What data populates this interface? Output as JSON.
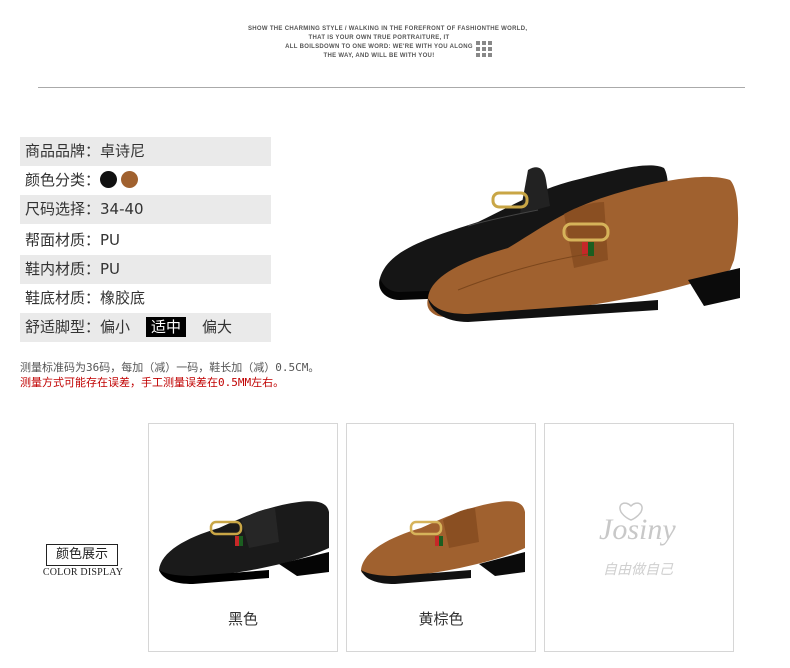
{
  "header": {
    "tagline_lines": [
      "SHOW THE CHARMING STYLE / WALKING IN THE FOREFRONT OF FASHIONTHE WORLD,",
      "THAT IS YOUR OWN TRUE PORTRAITURE, IT",
      "ALL BOILSDOWN TO ONE WORD: WE'RE WITH YOU ALONG",
      "THE WAY, AND WILL BE WITH YOU!"
    ]
  },
  "specs": {
    "brand": "商品品牌：卓诗尼",
    "color_label": "颜色分类：",
    "color_swatches": [
      "#111111",
      "#a0612f"
    ],
    "size": "尺码选择：34-40",
    "upper": "帮面材质：PU",
    "lining": "鞋内材质：PU",
    "sole": "鞋底材质：橡胶底",
    "fit_label": "舒适脚型：偏小",
    "fit_selected": "适中",
    "fit_large": "偏大"
  },
  "notes": {
    "size_note": "测量标准码为36码，每加（减）一码，鞋长加（减）0.5CM。",
    "error_note": "测量方式可能存在误差，手工测量误差在0.5MM左右。"
  },
  "color_display": {
    "title_cn": "颜色展示",
    "title_en": "COLOR DISPLAY",
    "cards": [
      {
        "caption": "黑色",
        "shoe_color": "#1a1a1a"
      },
      {
        "caption": "黄棕色",
        "shoe_color": "#a0612f"
      },
      {
        "caption": "",
        "logo": "Josiny",
        "logo_sub": "自由做自己"
      }
    ]
  },
  "colors": {
    "accent_red": "#c00000",
    "row_gray": "#eaeaea"
  }
}
